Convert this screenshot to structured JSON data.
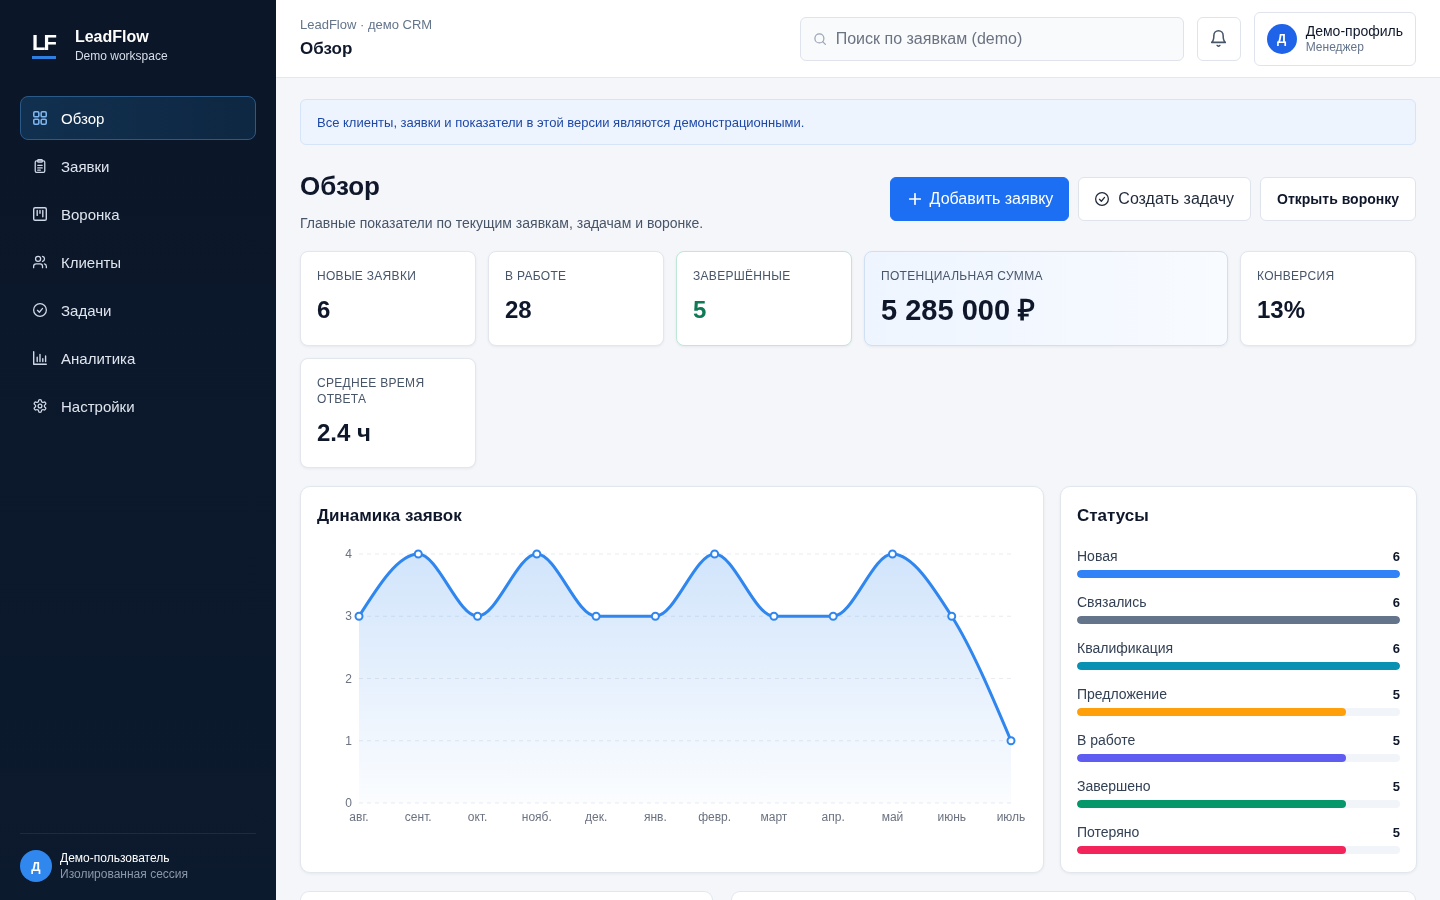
{
  "sidebar": {
    "brand": {
      "mark": "LF",
      "name": "LeadFlow",
      "subtitle": "Demo workspace"
    },
    "items": [
      {
        "label": "Обзор",
        "selected": true
      },
      {
        "label": "Заявки",
        "selected": false
      },
      {
        "label": "Воронка",
        "selected": false
      },
      {
        "label": "Клиенты",
        "selected": false
      },
      {
        "label": "Задачи",
        "selected": false
      },
      {
        "label": "Аналитика",
        "selected": false
      },
      {
        "label": "Настройки",
        "selected": false
      }
    ],
    "user": {
      "initial": "Д",
      "name": "Демо-пользователь",
      "note": "Изолированная сессия"
    }
  },
  "header": {
    "breadcrumb": "LeadFlow · демо CRM",
    "title": "Обзор",
    "search": {
      "placeholder": "Поиск по заявкам (demo)"
    },
    "profile": {
      "initial": "Д",
      "name": "Демо-профиль",
      "role": "Менеджер"
    }
  },
  "notice": "Все клиенты, заявки и показатели в этой версии являются демонстрационными.",
  "page": {
    "title": "Обзор",
    "subtitle": "Главные показатели по текущим заявкам, задачам и воронке.",
    "actions": [
      {
        "label": "Добавить заявку",
        "kind": "primary"
      },
      {
        "label": "Создать задачу",
        "kind": "secondary"
      },
      {
        "label": "Открыть воронку",
        "kind": "emphasis"
      }
    ]
  },
  "kpis": [
    {
      "label": "НОВЫЕ ЗАЯВКИ",
      "value": "6",
      "kind": "plain"
    },
    {
      "label": "В РАБОТЕ",
      "value": "28",
      "kind": "plain"
    },
    {
      "label": "ЗАВЕРШЁННЫЕ",
      "value": "5",
      "kind": "positive"
    },
    {
      "label": "ПОТЕНЦИАЛЬНАЯ СУММА",
      "value": "5 285 000 ₽",
      "kind": "accent"
    },
    {
      "label": "КОНВЕРСИЯ",
      "value": "13%",
      "kind": "plain"
    },
    {
      "label": "СРЕДНЕЕ ВРЕМЯ ОТВЕТА",
      "value": "2.4 ч",
      "kind": "plain"
    }
  ],
  "dynamics": {
    "chart_data": {
      "type": "area",
      "title": "Динамика заявок",
      "categories": [
        "авг.",
        "сент.",
        "окт.",
        "нояб.",
        "дек.",
        "янв.",
        "февр.",
        "март",
        "апр.",
        "май",
        "июнь",
        "июль"
      ],
      "values": [
        3,
        4,
        3,
        4,
        3,
        3,
        4,
        3,
        3,
        4,
        3,
        1
      ],
      "ylim": [
        0,
        4
      ],
      "yticks": [
        0,
        1,
        2,
        3,
        4
      ],
      "grid": true
    }
  },
  "statuses": {
    "title": "Статусы",
    "items": [
      {
        "label": "Новая",
        "count": "6",
        "level": 1,
        "color": "#3182f6"
      },
      {
        "label": "Связались",
        "count": "6",
        "level": 1,
        "color": "#64748b"
      },
      {
        "label": "Квалификация",
        "count": "6",
        "level": 1,
        "color": "#0891b2"
      },
      {
        "label": "Предложение",
        "count": "5",
        "level": 0.833,
        "color": "#ff9f0a"
      },
      {
        "label": "В работе",
        "count": "5",
        "level": 0.833,
        "color": "#5f5cf2"
      },
      {
        "label": "Завершено",
        "count": "5",
        "level": 0.833,
        "color": "#059669"
      },
      {
        "label": "Потеряно",
        "count": "5",
        "level": 0.833,
        "color": "#f2245a"
      }
    ]
  }
}
